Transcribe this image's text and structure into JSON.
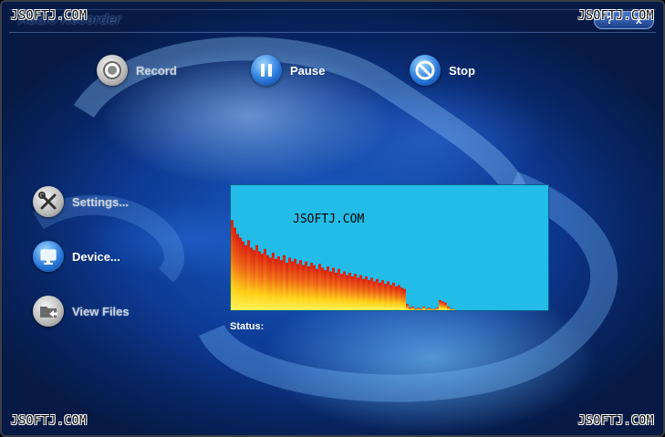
{
  "window": {
    "title": "Audio Recorder",
    "controls": [
      "?",
      "x"
    ]
  },
  "watermarks": {
    "top_left": "JSOFTJ.COM",
    "top_right": "JSOFTJ.COM",
    "bottom_left": "JSOFTJ.COM",
    "bottom_right": "JSOFTJ.COM"
  },
  "toolbar": {
    "record": {
      "label": "Record",
      "icon": "record-icon"
    },
    "pause": {
      "label": "Pause",
      "icon": "pause-icon"
    },
    "stop": {
      "label": "Stop",
      "icon": "stop-icon"
    }
  },
  "sidebar": {
    "items": [
      {
        "label": "Settings...",
        "icon": "wrench-screwdriver-icon"
      },
      {
        "label": "Device...",
        "icon": "monitor-icon"
      },
      {
        "label": "View Files",
        "icon": "folder-icon"
      }
    ]
  },
  "visualizer": {
    "watermark": "JSOFTJ.COM",
    "background": "#22bce6",
    "levels": [
      0.72,
      0.66,
      0.61,
      0.58,
      0.55,
      0.52,
      0.56,
      0.5,
      0.48,
      0.52,
      0.47,
      0.45,
      0.49,
      0.44,
      0.42,
      0.46,
      0.41,
      0.43,
      0.4,
      0.44,
      0.38,
      0.42,
      0.39,
      0.41,
      0.37,
      0.4,
      0.36,
      0.39,
      0.35,
      0.38,
      0.36,
      0.33,
      0.37,
      0.34,
      0.32,
      0.35,
      0.31,
      0.34,
      0.3,
      0.33,
      0.29,
      0.31,
      0.28,
      0.3,
      0.27,
      0.29,
      0.26,
      0.28,
      0.25,
      0.27,
      0.24,
      0.26,
      0.23,
      0.25,
      0.22,
      0.24,
      0.21,
      0.23,
      0.2,
      0.22,
      0.19,
      0.2,
      0.18,
      0.17,
      0.05,
      0.02,
      0.03,
      0.01,
      0.02,
      0.01,
      0.03,
      0.01,
      0.02,
      0.01,
      0.01,
      0.02,
      0.08,
      0.07,
      0.06,
      0.03,
      0.01,
      0.01,
      0.0,
      0.0,
      0.0,
      0.0,
      0.0,
      0.0
    ]
  },
  "status": {
    "label": "Status:"
  }
}
